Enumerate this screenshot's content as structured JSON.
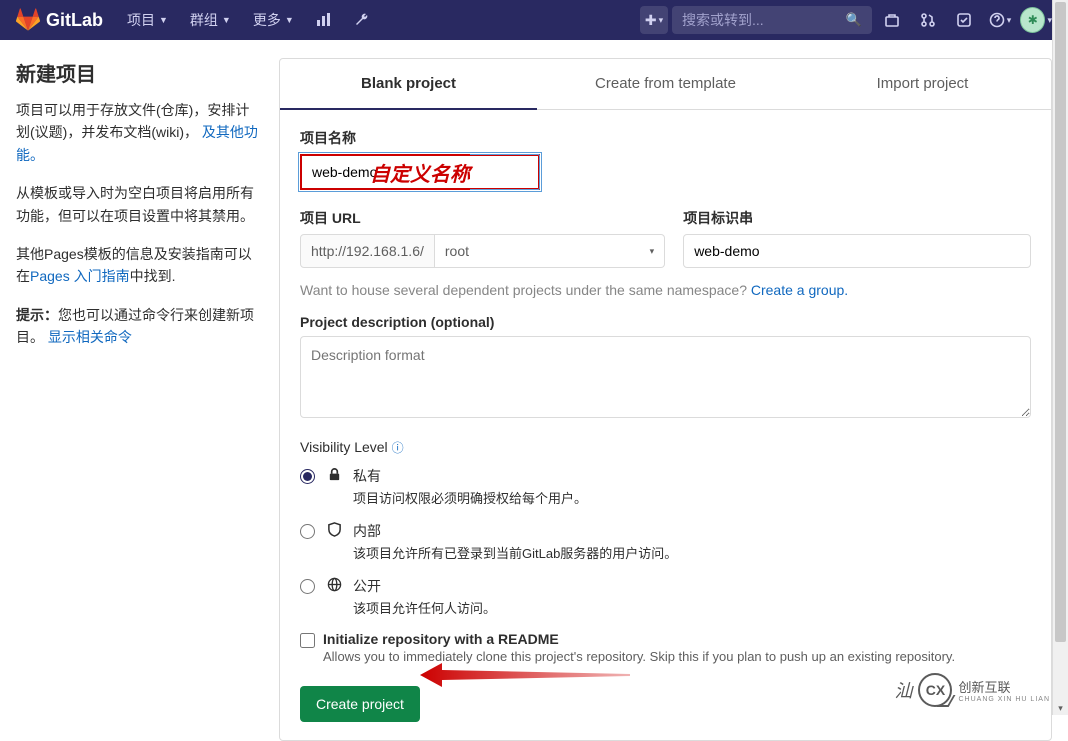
{
  "header": {
    "brand": "GitLab",
    "nav": {
      "projects": "项目",
      "groups": "群组",
      "more": "更多"
    },
    "search_placeholder": "搜索或转到..."
  },
  "sidebar": {
    "title": "新建项目",
    "p1_a": "项目可以用于存放文件(仓库)，安排计划(议题)，并发布文档(wiki)， ",
    "p1_link": "及其他功能。",
    "p2": "从模板或导入时为空白项目将启用所有功能，但可以在项目设置中将其禁用。",
    "p3_a": "其他Pages模板的信息及安装指南可以在",
    "p3_link": "Pages 入门指南",
    "p3_b": "中找到.",
    "tip_label": "提示：",
    "tip_text": "您也可以通过命令行来创建新项目。 ",
    "tip_link": "显示相关命令"
  },
  "tabs": {
    "blank": "Blank project",
    "template": "Create from template",
    "import": "Import project"
  },
  "form": {
    "name_label": "项目名称",
    "name_value": "web-demo",
    "annotation": "自定义名称",
    "url_label": "项目 URL",
    "url_prefix": "http://192.168.1.6/",
    "url_namespace": "root",
    "slug_label": "项目标识串",
    "slug_value": "web-demo",
    "namespace_hint_a": "Want to house several dependent projects under the same namespace? ",
    "namespace_hint_link": "Create a group.",
    "desc_label": "Project description (optional)",
    "desc_placeholder": "Description format",
    "vis_label": "Visibility Level",
    "vis": {
      "private": {
        "title": "私有",
        "desc": "项目访问权限必须明确授权给每个用户。"
      },
      "internal": {
        "title": "内部",
        "desc": "该项目允许所有已登录到当前GitLab服务器的用户访问。"
      },
      "public": {
        "title": "公开",
        "desc": "该项目允许任何人访问。"
      }
    },
    "readme_title": "Initialize repository with a README",
    "readme_desc": "Allows you to immediately clone this project's repository. Skip this if you plan to push up an existing repository.",
    "submit": "Create project"
  },
  "watermark": {
    "main": "创新互联",
    "sub": "CHUANG XIN HU LIAN"
  }
}
